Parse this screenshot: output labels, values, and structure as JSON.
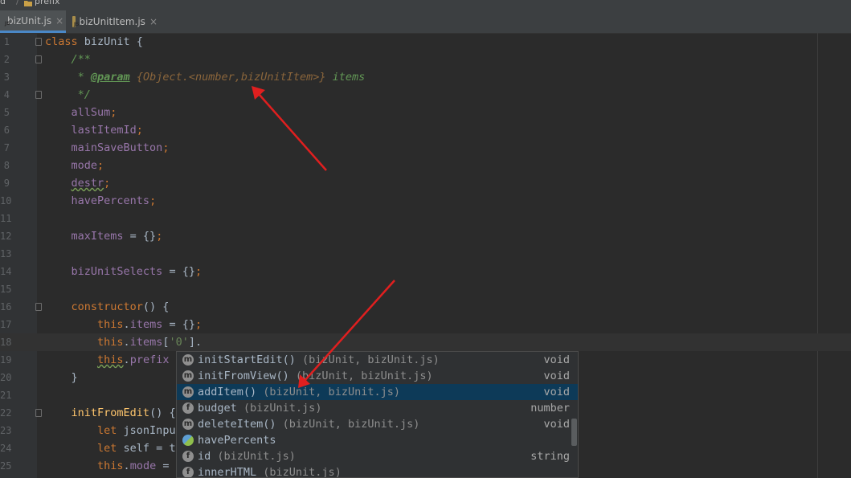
{
  "breadcrumb": [
    "d",
    "prefix"
  ],
  "tabs": [
    {
      "name": "bizUnit.js",
      "active": true
    },
    {
      "name": "bizUnitItem.js",
      "active": false
    }
  ],
  "editor": {
    "current_line": 18,
    "lines": [
      {
        "n": "1",
        "t": [
          [
            "kw",
            "class "
          ],
          [
            "",
            "bizUnit {"
          ]
        ]
      },
      {
        "n": "2",
        "t": [
          [
            "",
            "    "
          ],
          [
            "cm",
            "/**"
          ]
        ]
      },
      {
        "n": "3",
        "t": [
          [
            "",
            "     "
          ],
          [
            "cm",
            "* "
          ],
          [
            "tag",
            "@param"
          ],
          [
            "cm",
            " "
          ],
          [
            "typ",
            "{Object.<number,bizUnitItem>}"
          ],
          [
            "cm",
            " items"
          ]
        ]
      },
      {
        "n": "4",
        "t": [
          [
            "",
            "     "
          ],
          [
            "cm",
            "*/"
          ]
        ]
      },
      {
        "n": "5",
        "t": [
          [
            "",
            "    "
          ],
          [
            "fld",
            "allSum"
          ],
          [
            "kw",
            ";"
          ]
        ]
      },
      {
        "n": "6",
        "t": [
          [
            "",
            "    "
          ],
          [
            "fld",
            "lastItemId"
          ],
          [
            "kw",
            ";"
          ]
        ]
      },
      {
        "n": "7",
        "t": [
          [
            "",
            "    "
          ],
          [
            "fld",
            "mainSaveButton"
          ],
          [
            "kw",
            ";"
          ]
        ]
      },
      {
        "n": "8",
        "t": [
          [
            "",
            "    "
          ],
          [
            "fld",
            "mode"
          ],
          [
            "kw",
            ";"
          ]
        ]
      },
      {
        "n": "9",
        "t": [
          [
            "",
            "    "
          ],
          [
            "fld wavy",
            "destr"
          ],
          [
            "kw",
            ";"
          ]
        ]
      },
      {
        "n": "10",
        "t": [
          [
            "",
            "    "
          ],
          [
            "fld",
            "havePercents"
          ],
          [
            "kw",
            ";"
          ]
        ]
      },
      {
        "n": "11",
        "t": [
          [
            "",
            ""
          ]
        ]
      },
      {
        "n": "12",
        "t": [
          [
            "",
            "    "
          ],
          [
            "fld",
            "maxItems"
          ],
          [
            "",
            " = {}"
          ],
          [
            "kw",
            ";"
          ]
        ]
      },
      {
        "n": "13",
        "t": [
          [
            "",
            ""
          ]
        ]
      },
      {
        "n": "14",
        "t": [
          [
            "",
            "    "
          ],
          [
            "fld",
            "bizUnitSelects"
          ],
          [
            "",
            " = {}"
          ],
          [
            "kw",
            ";"
          ]
        ]
      },
      {
        "n": "15",
        "t": [
          [
            "",
            ""
          ]
        ]
      },
      {
        "n": "16",
        "t": [
          [
            "",
            "    "
          ],
          [
            "kw",
            "constructor"
          ],
          [
            "",
            "() {"
          ]
        ]
      },
      {
        "n": "17",
        "t": [
          [
            "",
            "        "
          ],
          [
            "kw",
            "this"
          ],
          [
            "",
            "."
          ],
          [
            "fld",
            "items"
          ],
          [
            "",
            " = {}"
          ],
          [
            "kw",
            ";"
          ]
        ]
      },
      {
        "n": "18",
        "t": [
          [
            "",
            "        "
          ],
          [
            "kw",
            "this"
          ],
          [
            "",
            "."
          ],
          [
            "fld",
            "items"
          ],
          [
            "",
            "["
          ],
          [
            "str",
            "'0'"
          ],
          [
            "",
            "]."
          ]
        ]
      },
      {
        "n": "19",
        "t": [
          [
            "",
            "        "
          ],
          [
            "kw wavy",
            "this"
          ],
          [
            "",
            "."
          ],
          [
            "fld",
            "prefix"
          ],
          [
            "",
            " = '"
          ]
        ]
      },
      {
        "n": "20",
        "t": [
          [
            "",
            "    }"
          ]
        ]
      },
      {
        "n": "21",
        "t": [
          [
            "",
            ""
          ]
        ]
      },
      {
        "n": "22",
        "t": [
          [
            "",
            "    "
          ],
          [
            "fn",
            "initFromEdit"
          ],
          [
            "",
            "() {"
          ]
        ]
      },
      {
        "n": "23",
        "t": [
          [
            "",
            "        "
          ],
          [
            "kw",
            "let "
          ],
          [
            "",
            "jsonInput"
          ]
        ]
      },
      {
        "n": "24",
        "t": [
          [
            "",
            "        "
          ],
          [
            "kw",
            "let "
          ],
          [
            "",
            "self = th"
          ]
        ]
      },
      {
        "n": "25",
        "t": [
          [
            "",
            "        "
          ],
          [
            "kw",
            "this"
          ],
          [
            "",
            "."
          ],
          [
            "fld",
            "mode"
          ],
          [
            "",
            " = '"
          ]
        ]
      }
    ]
  },
  "completion": {
    "selected_index": 2,
    "items": [
      {
        "kind": "m",
        "label": "initStartEdit()",
        "src": " (bizUnit, bizUnit.js)",
        "ret": "void"
      },
      {
        "kind": "m",
        "label": "initFromView()",
        "src": " (bizUnit, bizUnit.js)",
        "ret": "void"
      },
      {
        "kind": "m",
        "label": "addItem()",
        "src": " (bizUnit, bizUnit.js)",
        "ret": "void"
      },
      {
        "kind": "f",
        "label": "budget",
        "src": " (bizUnit.js)",
        "ret": "number"
      },
      {
        "kind": "m",
        "label": "deleteItem()",
        "src": " (bizUnit, bizUnit.js)",
        "ret": "void"
      },
      {
        "kind": "p",
        "label": "havePercents",
        "src": "",
        "ret": ""
      },
      {
        "kind": "f",
        "label": "id",
        "src": " (bizUnit.js)",
        "ret": "string"
      },
      {
        "kind": "f",
        "label": "innerHTML",
        "src": " (bizUnit.js)",
        "ret": ""
      }
    ]
  },
  "colors": {
    "annotation_arrow": "#e01f1f",
    "selection": "#0d3a58",
    "editor_bg": "#2b2b2b"
  }
}
